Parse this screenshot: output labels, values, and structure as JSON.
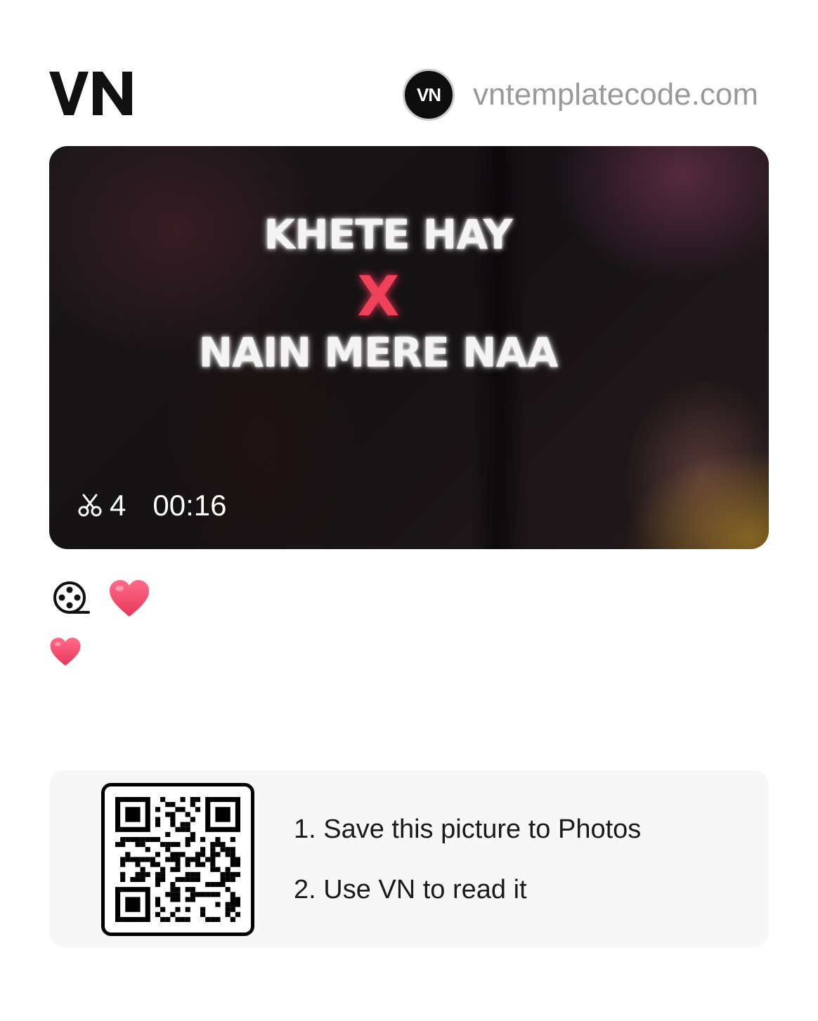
{
  "header": {
    "logo_icon": "vn-logo",
    "author_avatar_text": "VN",
    "author_name": "vntemplatecode.com"
  },
  "video": {
    "overlay_line1": "KHETE HAY",
    "overlay_x": "X",
    "overlay_line2": "NAIN MERE NAA",
    "clip_icon": "scissors-icon",
    "clip_count": "4",
    "duration": "00:16"
  },
  "actions": {
    "film_icon": "film-reel-icon",
    "heart_icon": "heart-icon",
    "caption_icon": "heart-icon"
  },
  "qr_panel": {
    "step1": "1. Save this picture to Photos",
    "step2": "2. Use VN to read it"
  },
  "colors": {
    "heart": "#f0476a",
    "overlay_x": "#f0415a",
    "author_text": "#9a9a9a",
    "panel_bg": "#f7f7f7"
  }
}
